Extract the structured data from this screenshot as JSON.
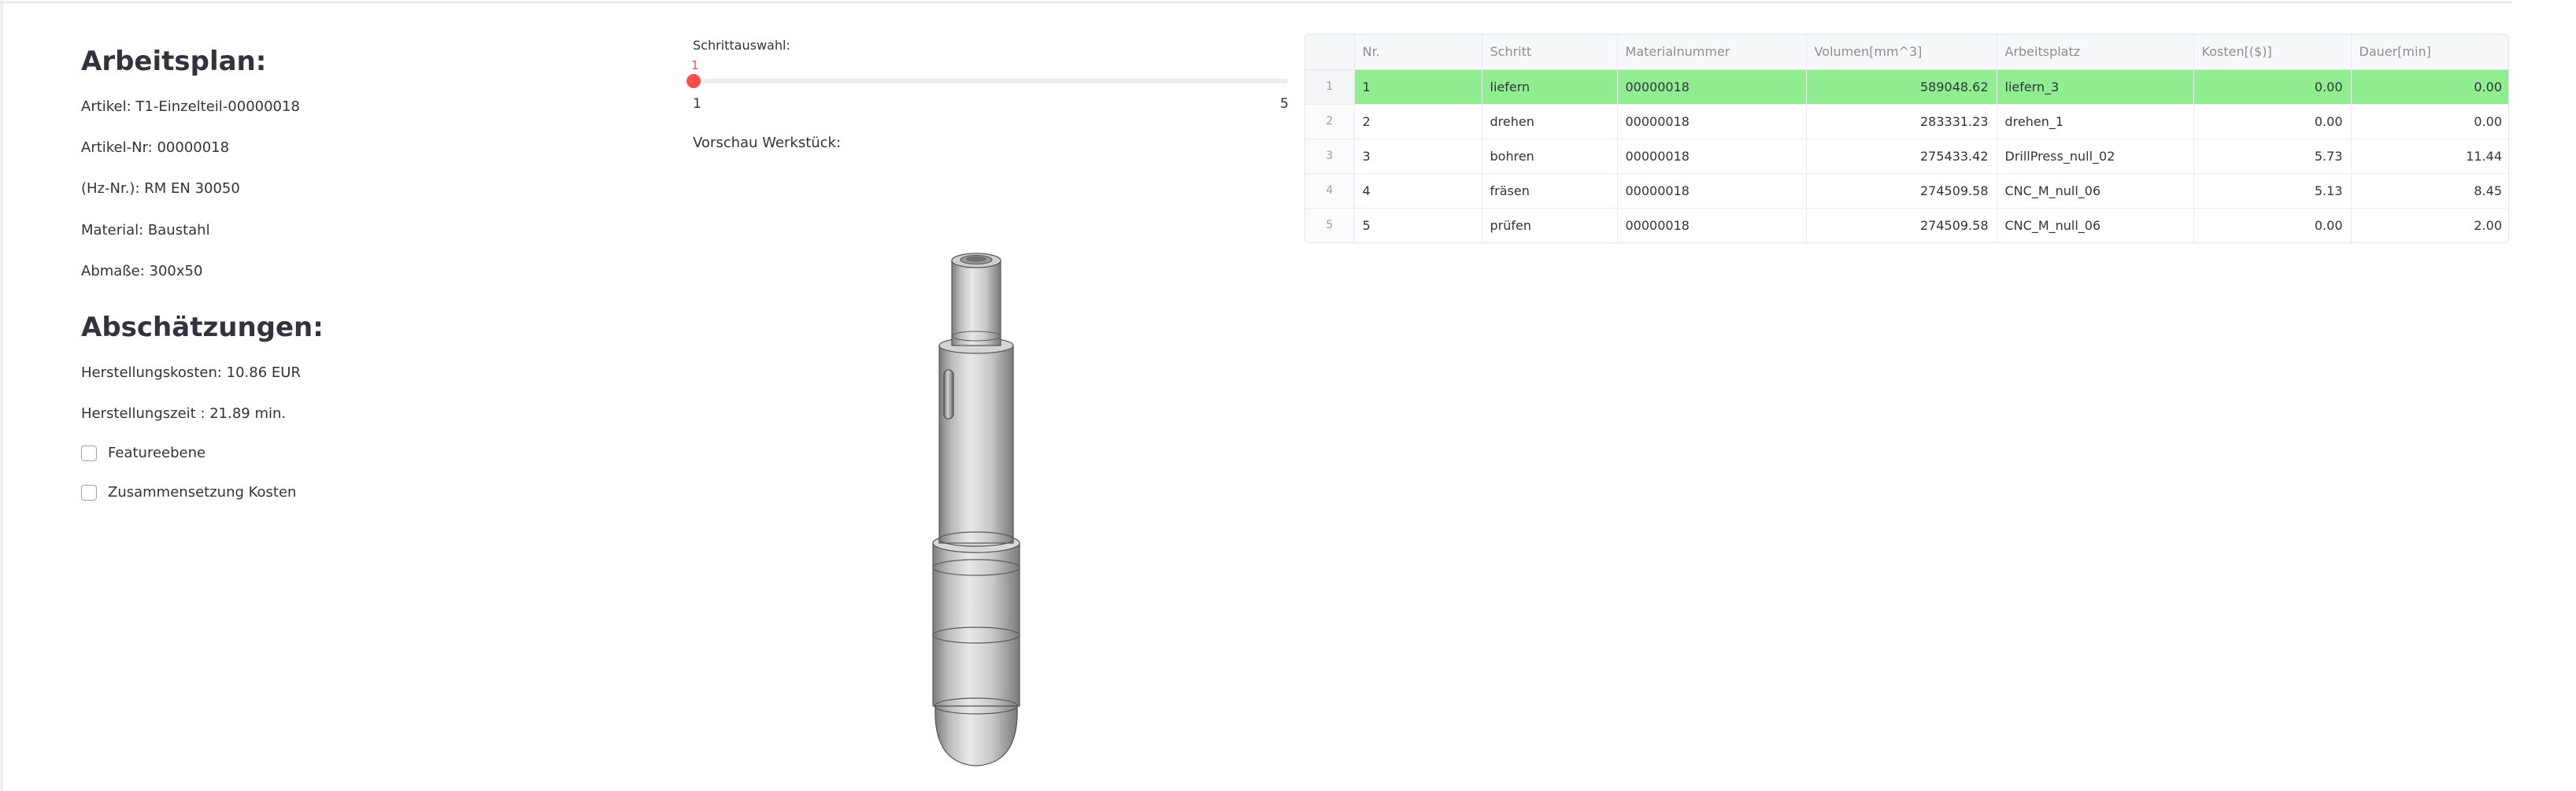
{
  "left": {
    "plan_heading": "Arbeitsplan:",
    "artikel": "Artikel: T1-Einzelteil-00000018",
    "artikel_nr": "Artikel-Nr: 00000018",
    "hz_nr": "(Hz-Nr.): RM EN 30050",
    "material": "Material: Baustahl",
    "abmasse": "Abmaße: 300x50",
    "estimate_heading": "Abschätzungen:",
    "kosten": "Herstellungskosten: 10.86 EUR",
    "zeit": "Herstellungszeit : 21.89 min.",
    "checkbox_feature": "Featureebene",
    "checkbox_kosten": "Zusammensetzung Kosten"
  },
  "slider": {
    "label": "Schrittauswahl:",
    "value": "1",
    "min": "1",
    "max": "5",
    "fill_fraction": 0.0
  },
  "preview": {
    "label": "Vorschau Werkstück:"
  },
  "table": {
    "headers": [
      "Nr.",
      "Schritt",
      "Materialnummer",
      "Volumen[mm^3]",
      "Arbeitsplatz",
      "Kosten[($)]",
      "Dauer[min]"
    ],
    "rows": [
      {
        "index": "1",
        "nr": "1",
        "schritt": "liefern",
        "material": "00000018",
        "volumen": "589048.62",
        "platz": "liefern_3",
        "kosten": "0.00",
        "dauer": "0.00"
      },
      {
        "index": "2",
        "nr": "2",
        "schritt": "drehen",
        "material": "00000018",
        "volumen": "283331.23",
        "platz": "drehen_1",
        "kosten": "0.00",
        "dauer": "0.00"
      },
      {
        "index": "3",
        "nr": "3",
        "schritt": "bohren",
        "material": "00000018",
        "volumen": "275433.42",
        "platz": "DrillPress_null_02",
        "kosten": "5.73",
        "dauer": "11.44"
      },
      {
        "index": "4",
        "nr": "4",
        "schritt": "fräsen",
        "material": "00000018",
        "volumen": "274509.58",
        "platz": "CNC_M_null_06",
        "kosten": "5.13",
        "dauer": "8.45"
      },
      {
        "index": "5",
        "nr": "5",
        "schritt": "prüfen",
        "material": "00000018",
        "volumen": "274509.58",
        "platz": "CNC_M_null_06",
        "kosten": "0.00",
        "dauer": "2.00"
      }
    ],
    "selected_row": 0,
    "highlight_color": "#90ee90"
  },
  "colors": {
    "accent": "#ff4b4b",
    "text": "#31333f"
  }
}
